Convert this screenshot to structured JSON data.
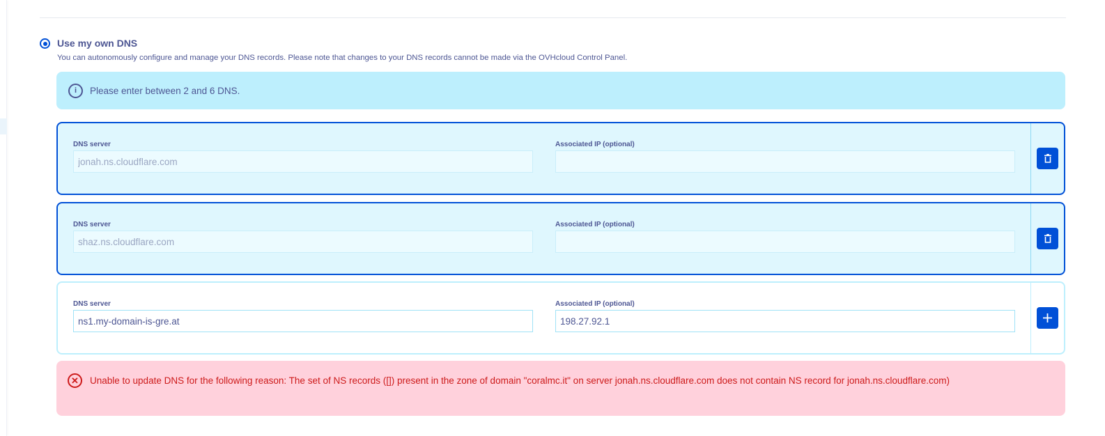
{
  "option": {
    "label": "Use my own DNS",
    "description": "You can autonomously configure and manage your DNS records. Please note that changes to your DNS records cannot be made via the OVHcloud Control Panel.",
    "selected": true
  },
  "info": {
    "icon": "info-icon",
    "text": "Please enter between 2 and 6 DNS."
  },
  "labels": {
    "server": "DNS server",
    "ip": "Associated IP (optional)"
  },
  "entries": [
    {
      "server": "jonah.ns.cloudflare.com",
      "ip": "",
      "action": "delete"
    },
    {
      "server": "shaz.ns.cloudflare.com",
      "ip": "",
      "action": "delete"
    }
  ],
  "new_entry": {
    "server": "ns1.my-domain-is-gre.at",
    "ip": "198.27.92.1",
    "action": "add"
  },
  "error": {
    "icon": "error-x-icon",
    "text": "Unable to update DNS for the following reason: The set of NS records ([]) present in the zone of domain \"coralmc.it\" on server jonah.ns.cloudflare.com does not contain NS record for jonah.ns.cloudflare.com)"
  },
  "colors": {
    "primary": "#0050d7",
    "info_bg": "#bdeffd",
    "error_bg": "#ffd1dc",
    "error_text": "#cd1a1a"
  }
}
